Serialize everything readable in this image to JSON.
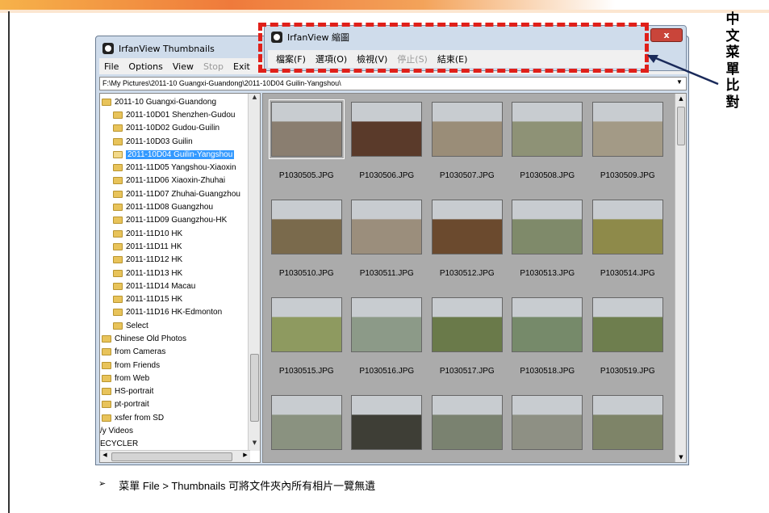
{
  "thumb_window": {
    "title": "IrfanView Thumbnails",
    "menu": [
      "File",
      "Options",
      "View",
      "Stop",
      "Exit"
    ],
    "menu_disabled_index": 3,
    "path": "F:\\My Pictures\\2011-10 Guangxi-Guandong\\2011-10D04 Guilin-Yangshou\\"
  },
  "tree_items": [
    {
      "label": "2011-10 Guangxi-Guandong",
      "indent": 0
    },
    {
      "label": "2011-10D01 Shenzhen-Gudou",
      "indent": 1
    },
    {
      "label": "2011-10D02 Gudou-Guilin",
      "indent": 1
    },
    {
      "label": "2011-10D03 Guilin",
      "indent": 1
    },
    {
      "label": "2011-10D04 Guilin-Yangshou",
      "indent": 1,
      "selected": true
    },
    {
      "label": "2011-11D05 Yangshou-Xiaoxin",
      "indent": 1
    },
    {
      "label": "2011-11D06 Xiaoxin-Zhuhai",
      "indent": 1
    },
    {
      "label": "2011-11D07 Zhuhai-Guangzhou",
      "indent": 1
    },
    {
      "label": "2011-11D08 Guangzhou",
      "indent": 1
    },
    {
      "label": "2011-11D09 Guangzhou-HK",
      "indent": 1
    },
    {
      "label": "2011-11D10 HK",
      "indent": 1
    },
    {
      "label": "2011-11D11 HK",
      "indent": 1
    },
    {
      "label": "2011-11D12 HK",
      "indent": 1
    },
    {
      "label": "2011-11D13 HK",
      "indent": 1
    },
    {
      "label": "2011-11D14 Macau",
      "indent": 1
    },
    {
      "label": "2011-11D15 HK",
      "indent": 1
    },
    {
      "label": "2011-11D16 HK-Edmonton",
      "indent": 1
    },
    {
      "label": "Select",
      "indent": 1
    },
    {
      "label": "Chinese Old Photos",
      "indent": 0
    },
    {
      "label": "from Cameras",
      "indent": 0
    },
    {
      "label": "from Friends",
      "indent": 0
    },
    {
      "label": "from Web",
      "indent": 0
    },
    {
      "label": "HS-portrait",
      "indent": 0
    },
    {
      "label": "pt-portrait",
      "indent": 0
    },
    {
      "label": "xsfer from SD",
      "indent": 0
    },
    {
      "label": "/y Videos",
      "indent": -1
    },
    {
      "label": "ECYCLER",
      "indent": -1
    }
  ],
  "thumbnails": [
    {
      "name": "P1030505.JPG",
      "color": "#8a7e70",
      "selected": true
    },
    {
      "name": "P1030506.JPG",
      "color": "#5a3a2a"
    },
    {
      "name": "P1030507.JPG",
      "color": "#9a8d78"
    },
    {
      "name": "P1030508.JPG",
      "color": "#8e9276"
    },
    {
      "name": "P1030509.JPG",
      "color": "#a39a86"
    },
    {
      "name": "P1030510.JPG",
      "color": "#7a6a4c"
    },
    {
      "name": "P1030511.JPG",
      "color": "#9b8e7c"
    },
    {
      "name": "P1030512.JPG",
      "color": "#6b4a2e"
    },
    {
      "name": "P1030513.JPG",
      "color": "#7f8a6a"
    },
    {
      "name": "P1030514.JPG",
      "color": "#8e8a4a"
    },
    {
      "name": "P1030515.JPG",
      "color": "#8e9a60"
    },
    {
      "name": "P1030516.JPG",
      "color": "#8c9a88"
    },
    {
      "name": "P1030517.JPG",
      "color": "#6a7a4a"
    },
    {
      "name": "P1030518.JPG",
      "color": "#768a6a"
    },
    {
      "name": "P1030519.JPG",
      "color": "#6e7e4e"
    },
    {
      "name": "",
      "color": "#8a9280"
    },
    {
      "name": "",
      "color": "#3e3e36"
    },
    {
      "name": "",
      "color": "#7a8270"
    },
    {
      "name": "",
      "color": "#8e9084"
    },
    {
      "name": "",
      "color": "#7e8468"
    }
  ],
  "chinese_window": {
    "title": "IrfanView 縮圖",
    "close": "x",
    "menu": [
      "檔案(F)",
      "選項(O)",
      "檢視(V)",
      "停止(S)",
      "結束(E)"
    ],
    "menu_disabled_index": 3
  },
  "annotation": {
    "vertical_label": [
      "中",
      "文",
      "菜",
      "單",
      "比",
      "對"
    ],
    "accent": "#e0201a"
  },
  "caption": {
    "mark": "➢",
    "text": "菜單 File > Thumbnails 可將文件夾內所有相片一覽無遺"
  }
}
